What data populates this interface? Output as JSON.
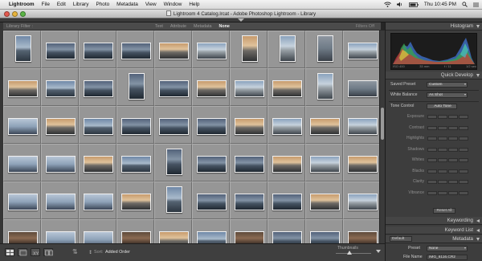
{
  "menubar": {
    "apple": "",
    "items": [
      "Lightroom",
      "File",
      "Edit",
      "Library",
      "Photo",
      "Metadata",
      "View",
      "Window",
      "Help"
    ],
    "time": "Thu 10:45 PM"
  },
  "window": {
    "title": "Lightroom 4 Catalog.lrcat - Adobe Photoshop Lightroom - Library"
  },
  "filterbar": {
    "label": "Library Filter :",
    "options": [
      "Text",
      "Attribute",
      "Metadata",
      "None"
    ],
    "active": "None",
    "filters_off": "Filters Off"
  },
  "grid": {
    "columns": 10,
    "rows": 6,
    "portrait_cells": [
      0,
      6,
      7,
      8,
      13,
      34,
      44
    ],
    "partial_cells": [
      18
    ]
  },
  "panel": {
    "histogram": {
      "title": "Histogram",
      "iso": "ISO 400",
      "focal": "33 mm",
      "aperture": "f / 11",
      "shutter": "1/2 sec"
    },
    "quick_develop": {
      "title": "Quick Develop",
      "saved_preset_label": "Saved Preset",
      "saved_preset_value": "Custom",
      "white_balance_label": "White Balance",
      "white_balance_value": "As Shot",
      "tone_control_label": "Tone Control",
      "auto_tone": "Auto Tone",
      "tone_rows": [
        "Exposure",
        "Contrast",
        "Highlights",
        "Shadows",
        "Whites",
        "Blacks",
        "Clarity",
        "Vibrance"
      ],
      "reset_all": "Reset All"
    },
    "keywording": {
      "title": "Keywording"
    },
    "keyword_list": {
      "title": "Keyword List"
    },
    "metadata": {
      "title": "Metadata",
      "preset_dropdown": "Default",
      "preset_label": "Preset",
      "preset_value": "None",
      "file_name_label": "File Name",
      "file_name_value": "IMG_6116.CR2"
    }
  },
  "toolbar": {
    "sort_label": "Sort:",
    "sort_value": "Added Order",
    "thumbnails_label": "Thumbnails"
  }
}
